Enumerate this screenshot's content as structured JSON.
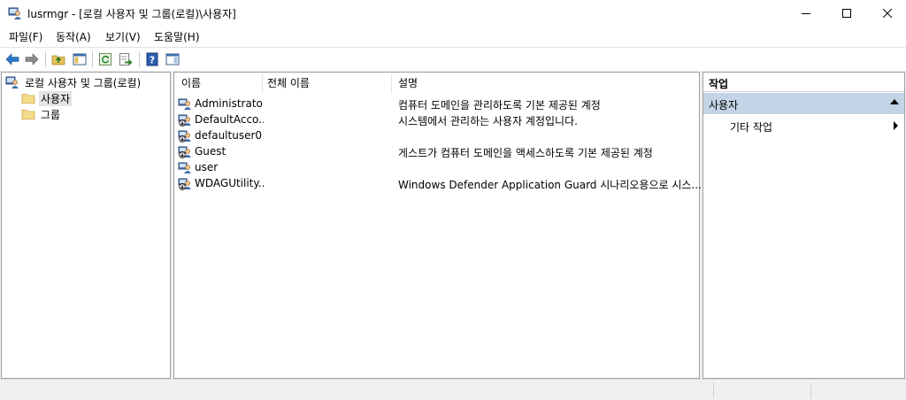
{
  "window": {
    "title": "lusrmgr - [로컬 사용자 및 그룹(로컬)\\사용자]",
    "icon": "computer-users-icon"
  },
  "menu": [
    {
      "label": "파일(F)"
    },
    {
      "label": "동작(A)"
    },
    {
      "label": "보기(V)"
    },
    {
      "label": "도움말(H)"
    }
  ],
  "toolbar": {
    "buttons": [
      "back-arrow-icon",
      "forward-arrow-icon",
      "up-folder-icon",
      "show-hide-tree-icon",
      "refresh-icon",
      "export-list-icon",
      "help-icon",
      "show-hide-action-pane-icon"
    ]
  },
  "tree": {
    "root": "로컬 사용자 및 그룹(로컬)",
    "children": [
      {
        "label": "사용자",
        "selected": true
      },
      {
        "label": "그룹",
        "selected": false
      }
    ]
  },
  "list": {
    "columns": [
      "이름",
      "전체 이름",
      "설명"
    ],
    "rows": [
      {
        "name": "Administrator",
        "full_name": "",
        "description": "컴퓨터 도메인을 관리하도록 기본 제공된 계정"
      },
      {
        "name": "DefaultAcco...",
        "full_name": "",
        "description": "시스템에서 관리하는 사용자 계정입니다."
      },
      {
        "name": "defaultuser0",
        "full_name": "",
        "description": ""
      },
      {
        "name": "Guest",
        "full_name": "",
        "description": "게스트가 컴퓨터 도메인을 액세스하도록 기본 제공된 계정"
      },
      {
        "name": "user",
        "full_name": "",
        "description": ""
      },
      {
        "name": "WDAGUtility...",
        "full_name": "",
        "description": "Windows Defender Application Guard 시나리오용으로 시스..."
      }
    ]
  },
  "actions": {
    "title": "작업",
    "section": "사용자",
    "more": "기타 작업"
  },
  "colors": {
    "selection": "#e5e5e5",
    "action_section_bg": "#c3d4e6",
    "pane_border": "#a0a0a0"
  }
}
